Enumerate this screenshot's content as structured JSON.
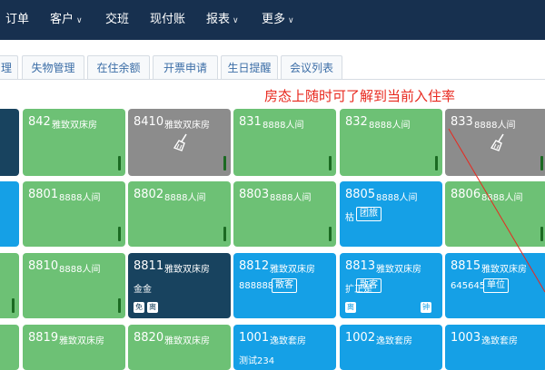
{
  "nav": {
    "items": [
      {
        "label": "订单",
        "dropdown": false
      },
      {
        "label": "客户",
        "dropdown": true
      },
      {
        "label": "交班",
        "dropdown": false
      },
      {
        "label": "现付账",
        "dropdown": false
      },
      {
        "label": "报表",
        "dropdown": true
      },
      {
        "label": "更多",
        "dropdown": true
      }
    ],
    "dropdown_glyph": "∨"
  },
  "tabs": [
    "理",
    "失物管理",
    "在住余额",
    "开票申请",
    "生日提醒",
    "会议列表"
  ],
  "annotation": "房态上随时可了解到当前入住率",
  "rooms": [
    {
      "num": "842",
      "type": "雅致双床房",
      "status": "green",
      "bar": true
    },
    {
      "num": "8410",
      "type": "雅致双床房",
      "status": "gray",
      "bar": true,
      "broom": true
    },
    {
      "num": "831",
      "type": "8888人间",
      "status": "green",
      "bar": true
    },
    {
      "num": "832",
      "type": "8888人间",
      "status": "green",
      "bar": true
    },
    {
      "num": "833",
      "type": "8888人间",
      "status": "gray",
      "bar": true,
      "broom": true
    },
    {
      "num": "8801",
      "type": "8888人间",
      "status": "green",
      "bar": true
    },
    {
      "num": "8802",
      "type": "8888人间",
      "status": "green",
      "bar": true
    },
    {
      "num": "8803",
      "type": "8888人间",
      "status": "green",
      "bar": true
    },
    {
      "num": "8805",
      "type": "8888人间",
      "status": "blue",
      "guest": "枯",
      "tag": "团旅"
    },
    {
      "num": "8806",
      "type": "8888人间",
      "status": "green",
      "bar": true
    },
    {
      "num": "8810",
      "type": "8888人间",
      "status": "green",
      "bar": true
    },
    {
      "num": "8811",
      "type": "雅致双床房",
      "status": "navy",
      "guest": "金金",
      "badges": [
        "免",
        "离"
      ]
    },
    {
      "num": "8812",
      "type": "雅致双床房",
      "status": "blue",
      "guest": "888888",
      "tag": "散客"
    },
    {
      "num": "8813",
      "type": "雅致双床房",
      "status": "blue",
      "guest": "扩正是",
      "tag": "散客",
      "badges": [
        "离",
        "钟"
      ]
    },
    {
      "num": "8815",
      "type": "雅致双床房",
      "status": "blue",
      "guest": "645645",
      "tag": "单位"
    },
    {
      "num": "8819",
      "type": "雅致双床房",
      "status": "green"
    },
    {
      "num": "8820",
      "type": "雅致双床房",
      "status": "green"
    },
    {
      "num": "1001",
      "type": "逸致套房",
      "status": "blue",
      "guest": "测试234"
    },
    {
      "num": "1002",
      "type": "逸致套房",
      "status": "blue"
    },
    {
      "num": "1003",
      "type": "逸致套房",
      "status": "blue"
    }
  ],
  "colors": {
    "topbar": "#17304f",
    "green": "#6dc175",
    "gray": "#8c8c8c",
    "blue": "#15a0e6",
    "navy": "#18435f",
    "annotation": "#e8281e"
  }
}
